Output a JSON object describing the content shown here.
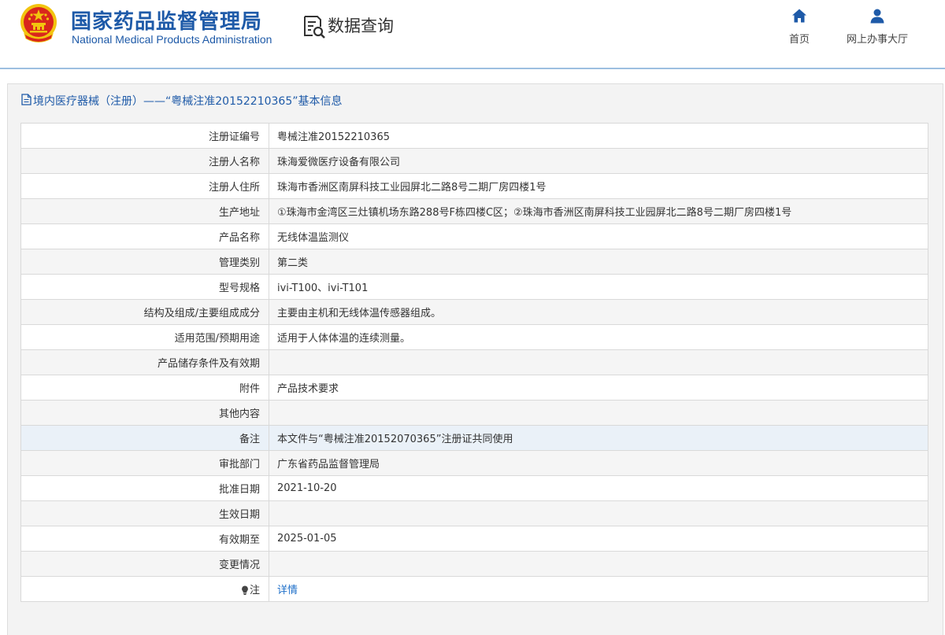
{
  "header": {
    "brand_cn": "国家药品监督管理局",
    "brand_en": "National Medical Products Administration",
    "query_title": "数据查询",
    "nav": [
      {
        "label": "首页",
        "icon": "home-icon"
      },
      {
        "label": "网上办事大厅",
        "icon": "user-icon"
      }
    ]
  },
  "panel": {
    "title": "境内医疗器械（注册）——“粤械注准20152210365”基本信息",
    "title_icon": "document-icon"
  },
  "rows": [
    {
      "label": "注册证编号",
      "value": "粤械注准20152210365"
    },
    {
      "label": "注册人名称",
      "value": "珠海爱微医疗设备有限公司"
    },
    {
      "label": "注册人住所",
      "value": "珠海市香洲区南屏科技工业园屏北二路8号二期厂房四楼1号"
    },
    {
      "label": "生产地址",
      "value": "①珠海市金湾区三灶镇机场东路288号F栋四楼C区；②珠海市香洲区南屏科技工业园屏北二路8号二期厂房四楼1号"
    },
    {
      "label": "产品名称",
      "value": "无线体温监测仪"
    },
    {
      "label": "管理类别",
      "value": "第二类"
    },
    {
      "label": "型号规格",
      "value": "ivi-T100、ivi-T101"
    },
    {
      "label": "结构及组成/主要组成成分",
      "value": "主要由主机和无线体温传感器组成。"
    },
    {
      "label": "适用范围/预期用途",
      "value": "适用于人体体温的连续测量。"
    },
    {
      "label": "产品储存条件及有效期",
      "value": ""
    },
    {
      "label": "附件",
      "value": "产品技术要求"
    },
    {
      "label": "其他内容",
      "value": ""
    },
    {
      "label": "备注",
      "value": "本文件与“粤械注准20152070365”注册证共同使用"
    },
    {
      "label": "审批部门",
      "value": "广东省药品监督管理局"
    },
    {
      "label": "批准日期",
      "value": "2021-10-20"
    },
    {
      "label": "生效日期",
      "value": ""
    },
    {
      "label": "有效期至",
      "value": "2025-01-05"
    },
    {
      "label": "变更情况",
      "value": ""
    }
  ],
  "note_row": {
    "label": "注",
    "link": "详情",
    "icon": "lightbulb-icon"
  },
  "colors": {
    "brand": "#1e5aa8",
    "link": "#1e6fc9",
    "emblem_red": "#d9261c",
    "emblem_gold": "#f2c40f"
  }
}
